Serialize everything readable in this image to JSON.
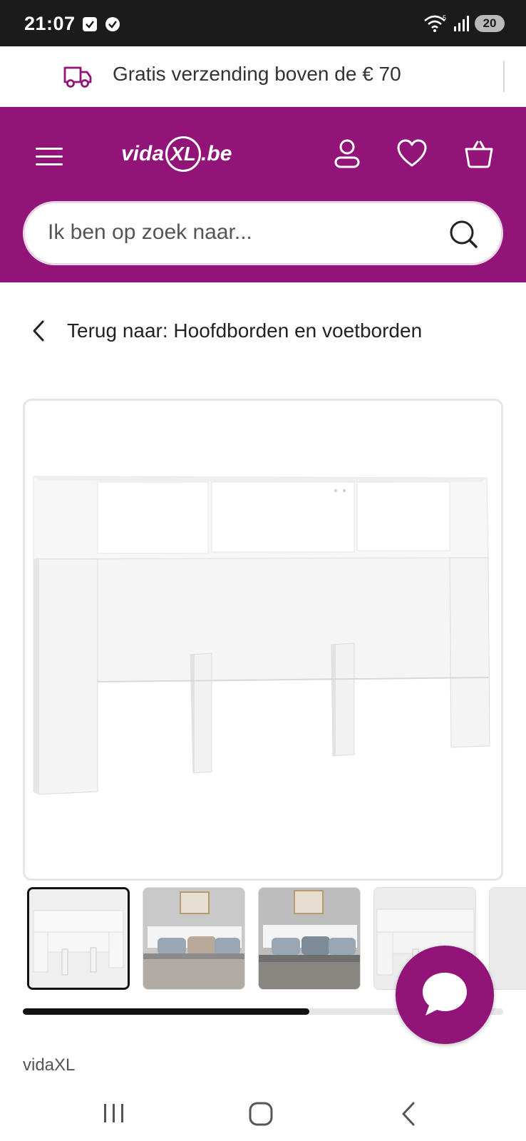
{
  "status_bar": {
    "time": "21:07",
    "battery": "20",
    "icons": [
      "check-square-icon",
      "check-circle-icon",
      "wifi-icon",
      "signal-icon",
      "battery-icon"
    ]
  },
  "promo": {
    "text": "Gratis verzending boven de € 70",
    "icon": "delivery-truck-icon"
  },
  "header": {
    "logo_prefix": "vida",
    "logo_mark": "XL",
    "logo_suffix": ".be",
    "icons": [
      "menu-icon",
      "account-icon",
      "wishlist-heart-icon",
      "cart-basket-icon"
    ],
    "brand_color": "#921478"
  },
  "search": {
    "placeholder": "Ik ben op zoek naar..."
  },
  "breadcrumb": {
    "back_text": "Terug naar: Hoofdborden en voetborden"
  },
  "gallery": {
    "thumbnails": [
      "headboard-product-front",
      "headboard-bedroom-light",
      "headboard-bedroom-dark",
      "headboard-product-angle",
      "headboard-more"
    ],
    "active_index": 0,
    "scroll_progress": 0.6
  },
  "product": {
    "brand": "vidaXL"
  },
  "nav_bar": {
    "buttons": [
      "recent-apps-icon",
      "home-icon",
      "back-icon"
    ]
  }
}
